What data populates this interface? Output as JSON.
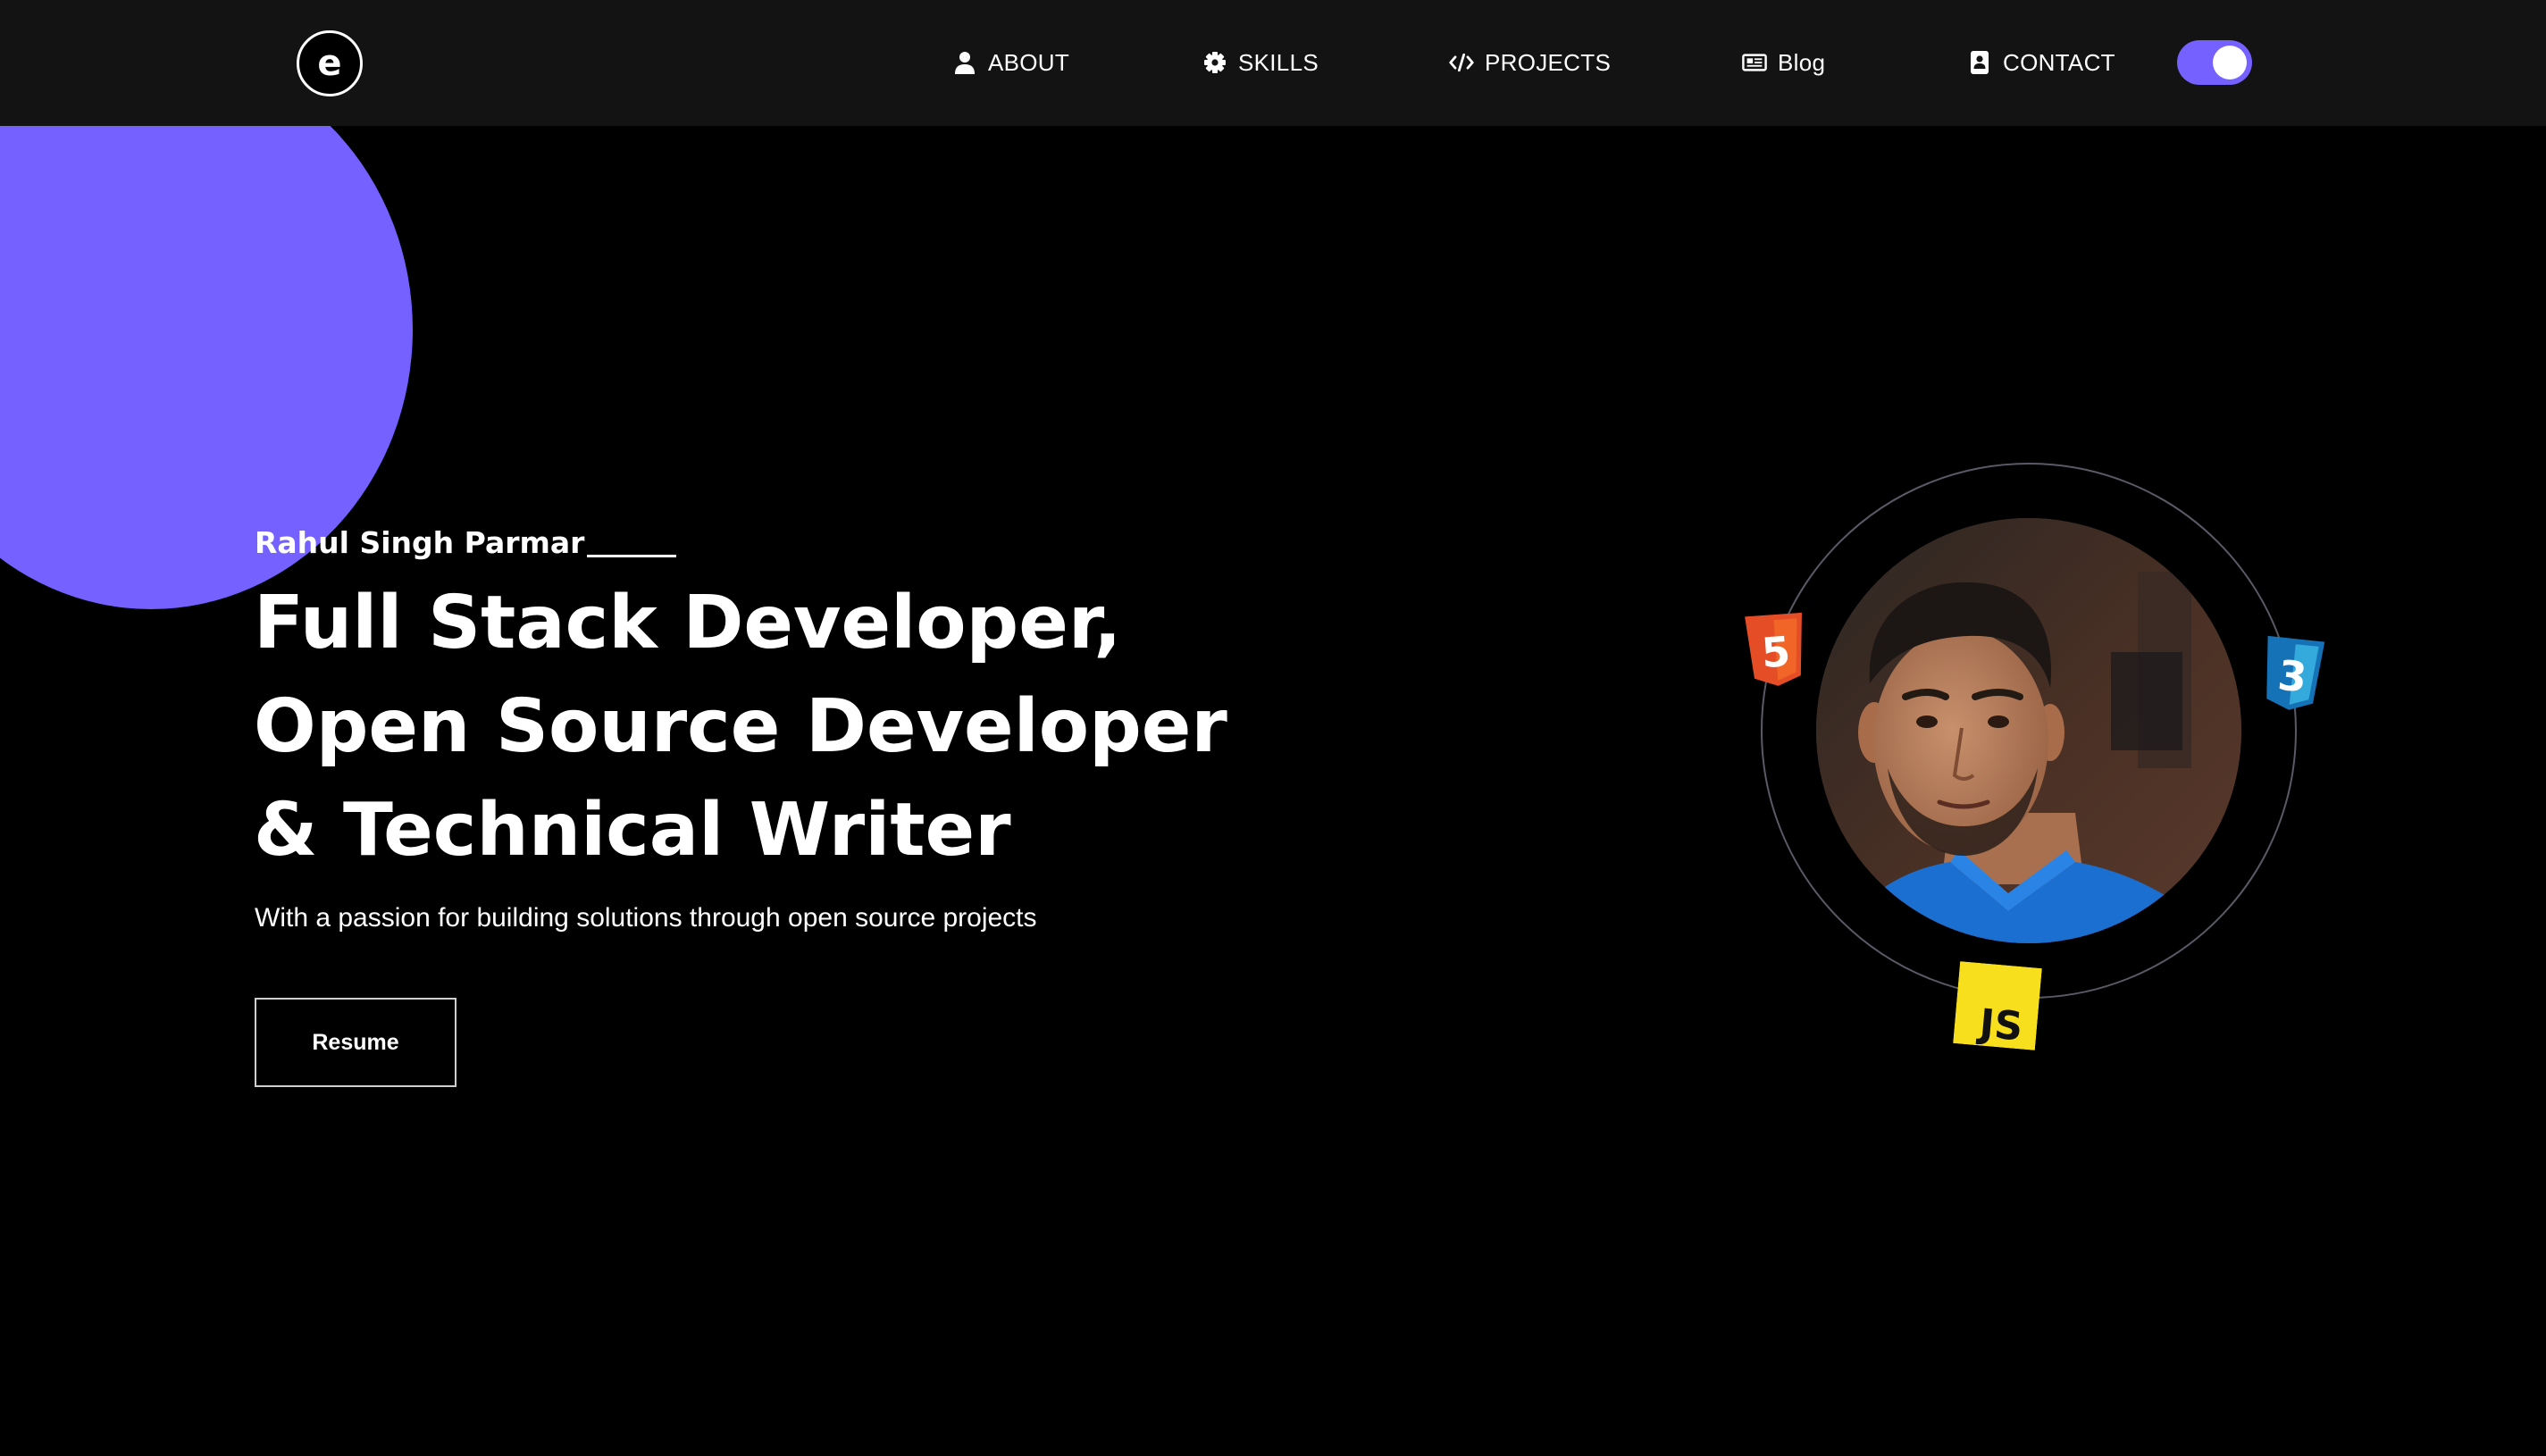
{
  "nav": {
    "logo_letter": "e",
    "items": [
      {
        "label": "ABOUT",
        "icon": "user-icon"
      },
      {
        "label": "SKILLS",
        "icon": "gear-icon"
      },
      {
        "label": "PROJECTS",
        "icon": "code-icon"
      },
      {
        "label": "Blog",
        "icon": "newspaper-icon"
      },
      {
        "label": "CONTACT",
        "icon": "contact-card-icon"
      }
    ],
    "theme_toggle": {
      "state": "on",
      "color": "#7461ff"
    }
  },
  "hero": {
    "name": "Rahul Singh Parmar",
    "title_lines": [
      "Full Stack Developer,",
      "Open Source Developer",
      "& Technical Writer"
    ],
    "subtitle": "With a passion for building solutions through open source projects",
    "resume_label": "Resume"
  },
  "badges": {
    "html": {
      "label": "5",
      "color": "#e44d26"
    },
    "css": {
      "label": "3",
      "color": "#1572b6"
    },
    "js": {
      "label": "JS",
      "color": "#f7df1e"
    }
  },
  "colors": {
    "accent": "#7461ff",
    "nav_background": "#131313",
    "page_background": "#000000"
  }
}
